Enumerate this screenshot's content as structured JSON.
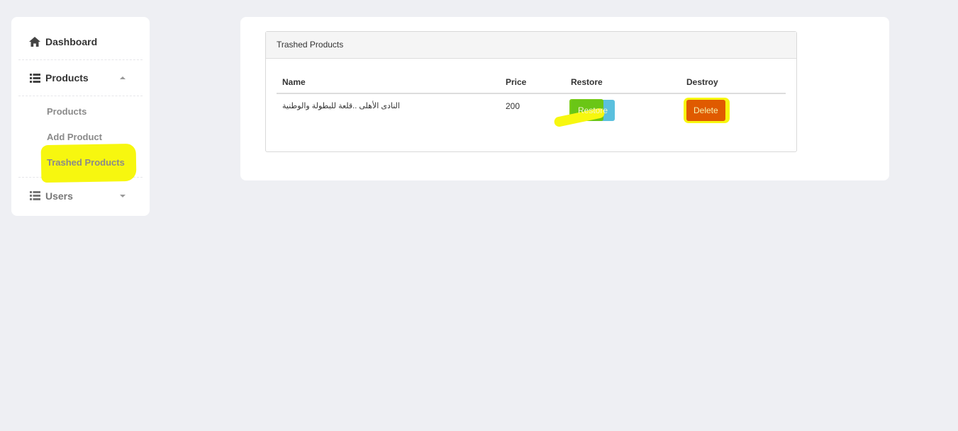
{
  "sidebar": {
    "dashboard_label": "Dashboard",
    "products_label": "Products",
    "products_sub": [
      "Products",
      "Add Product",
      "Trashed Products"
    ],
    "users_label": "Users"
  },
  "panel": {
    "title": "Trashed Products",
    "columns": [
      "Name",
      "Price",
      "Restore",
      "Destroy"
    ],
    "rows": [
      {
        "name": "النادى الأهلى ..قلعة للبطولة والوطنية",
        "price": "200",
        "restore_label": "Restore",
        "delete_label": "Delete"
      }
    ]
  },
  "colors": {
    "background": "#eeeff3",
    "highlight": "#f7f70f",
    "restore_button": "#5bc0de",
    "delete_button": "#d9534f"
  },
  "icons": [
    "home-icon",
    "list-icon",
    "caret-up-icon",
    "caret-down-icon"
  ]
}
